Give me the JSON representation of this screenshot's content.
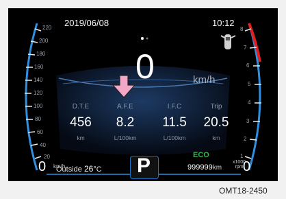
{
  "status": {
    "date": "2019/06/08",
    "time": "10:12"
  },
  "speed": {
    "value": "0",
    "unit": "km/h"
  },
  "trip_info": [
    {
      "label": "D.T.E",
      "value": "456",
      "unit": "km"
    },
    {
      "label": "A.F.E",
      "value": "8.2",
      "unit": "L/100km"
    },
    {
      "label": "I.F.C",
      "value": "11.5",
      "unit": "L/100km"
    },
    {
      "label": "Trip",
      "value": "20.5",
      "unit": "km"
    }
  ],
  "speedometer": {
    "ticks": [
      "220",
      "200",
      "180",
      "160",
      "140",
      "120",
      "100",
      "80",
      "60",
      "40",
      "20"
    ],
    "zero": "0",
    "unit": "km/h"
  },
  "tachometer": {
    "ticks": [
      "8",
      "7",
      "6",
      "5",
      "4",
      "3",
      "2",
      "1"
    ],
    "zero": "0",
    "unit_top": "x1000",
    "unit_bottom": "rpm"
  },
  "outside_temp": {
    "label": "Outside",
    "value": "26",
    "unit": "°C"
  },
  "gear": "P",
  "mode": "ECO",
  "odometer": {
    "value": "999999",
    "unit": "km"
  },
  "figure_code": "OMT18-2450",
  "colors": {
    "gauge_blue": "#2f8fe0",
    "redline": "#e02020",
    "eco": "#3ab54a",
    "arrow": "#f3a7c6"
  },
  "icons": [
    "door-open-icon",
    "pointer-arrow-icon"
  ]
}
